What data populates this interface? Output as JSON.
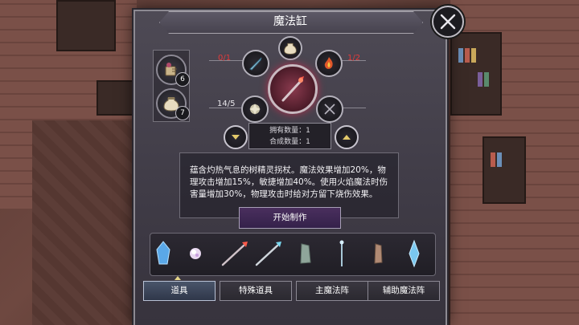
{
  "window": {
    "title": "魔法缸"
  },
  "side_slots": [
    {
      "icon": "scroll-potion-icon",
      "count": "6"
    },
    {
      "icon": "jar-icon",
      "count": "7"
    }
  ],
  "recipe": {
    "top_icon": "jar-icon",
    "left_top": {
      "icon": "blade-icon",
      "count": "0/1"
    },
    "right_top": {
      "icon": "flame-essence-icon",
      "count": "1/2"
    },
    "left_bottom": {
      "icon": "crystal-orb-icon",
      "count": "14/5"
    },
    "right_bottom": {
      "icon": "empty-slot-icon"
    },
    "center": {
      "icon": "staff-icon"
    },
    "owned_label": "拥有数量：1",
    "craft_label": "合成数量：1"
  },
  "description": "蕴含灼热气息的树精灵拐杖。魔法效果增加20%，物理攻击增加15%，敏捷增加40%。使用火焰魔法时伤害量增加30%，物理攻击时给对方留下烧伤效果。",
  "start_button": "开始制作",
  "inventory": [
    {
      "icon": "blue-crystal-icon"
    },
    {
      "icon": "pearl-orb-icon"
    },
    {
      "icon": "fire-staff-icon"
    },
    {
      "icon": "ice-staff-icon"
    },
    {
      "icon": "stone-shard-icon"
    },
    {
      "icon": "thin-wand-icon"
    },
    {
      "icon": "wood-shard-icon"
    },
    {
      "icon": "ice-shard-icon"
    }
  ],
  "tabs": [
    {
      "label": "道具",
      "active": true
    },
    {
      "label": "特殊道具",
      "active": false
    },
    {
      "label": "主魔法阵",
      "active": false
    },
    {
      "label": "辅助魔法阵",
      "active": false
    }
  ],
  "colors": {
    "accent_red": "#e23b3b",
    "panel": "#45414c",
    "active_tab": "#3d4659"
  }
}
